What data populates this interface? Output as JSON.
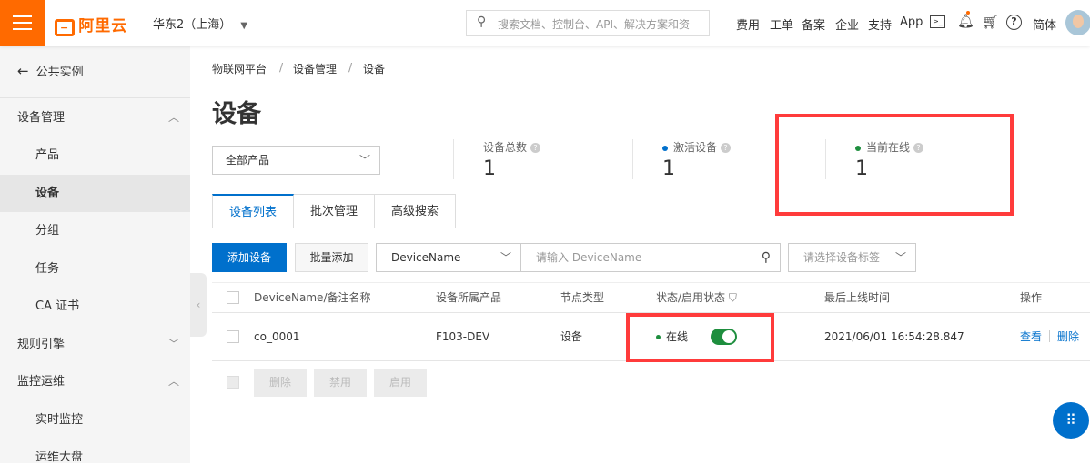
{
  "header": {
    "logo": "阿里云",
    "region": "华东2（上海）",
    "search_placeholder": "搜索文档、控制台、API、解决方案和资",
    "nav": [
      "费用",
      "工单",
      "备案",
      "企业",
      "支持",
      "App"
    ],
    "lang": "简体"
  },
  "sidebar": {
    "back": "公共实例",
    "items": [
      {
        "label": "设备管理"
      },
      {
        "label": "产品"
      },
      {
        "label": "设备"
      },
      {
        "label": "分组"
      },
      {
        "label": "任务"
      },
      {
        "label": "CA 证书"
      },
      {
        "label": "规则引擎"
      },
      {
        "label": "监控运维"
      },
      {
        "label": "实时监控"
      },
      {
        "label": "运维大盘"
      }
    ]
  },
  "breadcrumb": [
    "物联网平台",
    "设备管理",
    "设备"
  ],
  "title": "设备",
  "product_select": "全部产品",
  "stats": [
    {
      "label": "设备总数",
      "value": "1"
    },
    {
      "label": "激活设备",
      "value": "1",
      "dot": "#0070cc"
    },
    {
      "label": "当前在线",
      "value": "1",
      "dot": "#1e8e3e"
    }
  ],
  "tabs": [
    "设备列表",
    "批次管理",
    "高级搜索"
  ],
  "toolbar": {
    "add": "添加设备",
    "batch_add": "批量添加",
    "field_select": "DeviceName",
    "input_placeholder": "请输入 DeviceName",
    "tag_placeholder": "请选择设备标签"
  },
  "table": {
    "headers": [
      "DeviceName/备注名称",
      "设备所属产品",
      "节点类型",
      "状态/启用状态",
      "最后上线时间",
      "操作"
    ],
    "rows": [
      {
        "name": "co_0001",
        "product": "F103-DEV",
        "type": "设备",
        "status": "在线",
        "enabled": true,
        "last_online": "2021/06/01 16:54:28.847",
        "actions": [
          "查看",
          "删除"
        ]
      }
    ]
  },
  "bulk": [
    "删除",
    "禁用",
    "启用"
  ],
  "colors": {
    "accent": "#0070cc",
    "brand": "#ff6a00",
    "online": "#1e8e3e",
    "highlight": "#ff3b3b"
  }
}
